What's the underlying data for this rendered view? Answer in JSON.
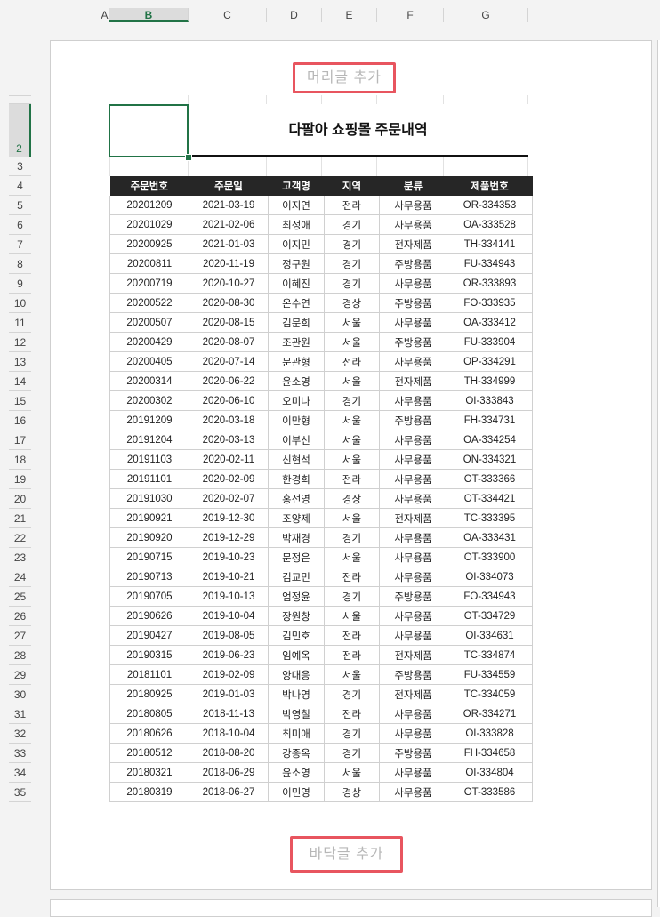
{
  "columns": [
    "A",
    "B",
    "C",
    "D",
    "E",
    "F",
    "G"
  ],
  "rows": [
    "2",
    "3",
    "4",
    "5",
    "6",
    "7",
    "8",
    "9",
    "10",
    "11",
    "12",
    "13",
    "14",
    "15",
    "16",
    "17",
    "18",
    "19",
    "20",
    "21",
    "22",
    "23",
    "24",
    "25",
    "26",
    "27",
    "28",
    "29",
    "30",
    "31",
    "32",
    "33",
    "34",
    "35"
  ],
  "header_placeholder": "머리글 추가",
  "footer_placeholder": "바닥글 추가",
  "title": "다팔아 쇼핑몰 주문내역",
  "table": {
    "headers": [
      "주문번호",
      "주문일",
      "고객명",
      "지역",
      "분류",
      "제품번호"
    ],
    "rows": [
      [
        "20201209",
        "2021-03-19",
        "이지연",
        "전라",
        "사무용품",
        "OR-334353"
      ],
      [
        "20201029",
        "2021-02-06",
        "최정애",
        "경기",
        "사무용품",
        "OA-333528"
      ],
      [
        "20200925",
        "2021-01-03",
        "이지민",
        "경기",
        "전자제품",
        "TH-334141"
      ],
      [
        "20200811",
        "2020-11-19",
        "정구원",
        "경기",
        "주방용품",
        "FU-334943"
      ],
      [
        "20200719",
        "2020-10-27",
        "이혜진",
        "경기",
        "사무용품",
        "OR-333893"
      ],
      [
        "20200522",
        "2020-08-30",
        "온수연",
        "경상",
        "주방용품",
        "FO-333935"
      ],
      [
        "20200507",
        "2020-08-15",
        "김문희",
        "서울",
        "사무용품",
        "OA-333412"
      ],
      [
        "20200429",
        "2020-08-07",
        "조관원",
        "서울",
        "주방용품",
        "FU-333904"
      ],
      [
        "20200405",
        "2020-07-14",
        "문관형",
        "전라",
        "사무용품",
        "OP-334291"
      ],
      [
        "20200314",
        "2020-06-22",
        "윤소영",
        "서울",
        "전자제품",
        "TH-334999"
      ],
      [
        "20200302",
        "2020-06-10",
        "오미나",
        "경기",
        "사무용품",
        "OI-333843"
      ],
      [
        "20191209",
        "2020-03-18",
        "이만형",
        "서울",
        "주방용품",
        "FH-334731"
      ],
      [
        "20191204",
        "2020-03-13",
        "이부선",
        "서울",
        "사무용품",
        "OA-334254"
      ],
      [
        "20191103",
        "2020-02-11",
        "신현석",
        "서울",
        "사무용품",
        "ON-334321"
      ],
      [
        "20191101",
        "2020-02-09",
        "한경희",
        "전라",
        "사무용품",
        "OT-333366"
      ],
      [
        "20191030",
        "2020-02-07",
        "홍선영",
        "경상",
        "사무용품",
        "OT-334421"
      ],
      [
        "20190921",
        "2019-12-30",
        "조양제",
        "서울",
        "전자제품",
        "TC-333395"
      ],
      [
        "20190920",
        "2019-12-29",
        "박재경",
        "경기",
        "사무용품",
        "OA-333431"
      ],
      [
        "20190715",
        "2019-10-23",
        "문정은",
        "서울",
        "사무용품",
        "OT-333900"
      ],
      [
        "20190713",
        "2019-10-21",
        "김교민",
        "전라",
        "사무용품",
        "OI-334073"
      ],
      [
        "20190705",
        "2019-10-13",
        "엄정윤",
        "경기",
        "주방용품",
        "FO-334943"
      ],
      [
        "20190626",
        "2019-10-04",
        "장원창",
        "서울",
        "사무용품",
        "OT-334729"
      ],
      [
        "20190427",
        "2019-08-05",
        "김민호",
        "전라",
        "사무용품",
        "OI-334631"
      ],
      [
        "20190315",
        "2019-06-23",
        "임예옥",
        "전라",
        "전자제품",
        "TC-334874"
      ],
      [
        "20181101",
        "2019-02-09",
        "양대응",
        "서울",
        "주방용품",
        "FU-334559"
      ],
      [
        "20180925",
        "2019-01-03",
        "박나영",
        "경기",
        "전자제품",
        "TC-334059"
      ],
      [
        "20180805",
        "2018-11-13",
        "박영철",
        "전라",
        "사무용품",
        "OR-334271"
      ],
      [
        "20180626",
        "2018-10-04",
        "최미애",
        "경기",
        "사무용품",
        "OI-333828"
      ],
      [
        "20180512",
        "2018-08-20",
        "강종옥",
        "경기",
        "주방용품",
        "FH-334658"
      ],
      [
        "20180321",
        "2018-06-29",
        "윤소영",
        "서울",
        "사무용품",
        "OI-334804"
      ],
      [
        "20180319",
        "2018-06-27",
        "이민영",
        "경상",
        "사무용품",
        "OT-333586"
      ]
    ]
  },
  "colors": {
    "accent": "#217346",
    "highlight_box": "#e8555f",
    "header_bg": "#262626"
  }
}
